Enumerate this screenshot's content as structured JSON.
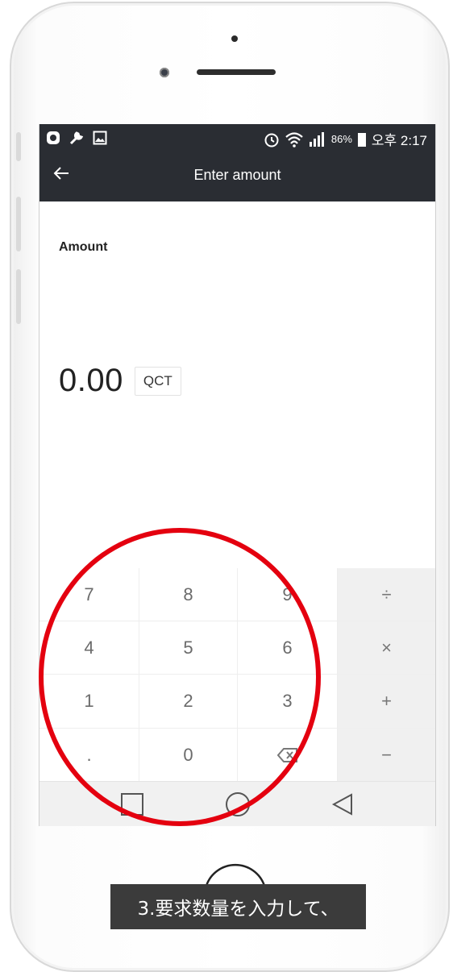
{
  "status_bar": {
    "battery_percent": "86%",
    "time": "오후 2:17",
    "left_icons": [
      "app-icon",
      "wrench-icon",
      "image-icon"
    ],
    "right_icons": [
      "alarm-icon",
      "wifi-icon",
      "signal-icon",
      "battery-icon"
    ]
  },
  "app_bar": {
    "back_icon": "arrow-left-icon",
    "title": "Enter amount"
  },
  "amount": {
    "label": "Amount",
    "value": "0.00",
    "unit": "QCT"
  },
  "keypad": {
    "rows": [
      [
        "7",
        "8",
        "9",
        "÷"
      ],
      [
        "4",
        "5",
        "6",
        "×"
      ],
      [
        "1",
        "2",
        "3",
        "+"
      ],
      [
        ".",
        "0",
        "backspace-icon",
        "−"
      ]
    ]
  },
  "nav_bar": [
    "square-icon",
    "circle-icon",
    "triangle-left-icon"
  ],
  "annotation": {
    "caption": "3.要求数量を入力して、",
    "highlight_color": "#e4000f"
  },
  "colors": {
    "app_bar": "#2a2d33",
    "operator_keys": "#f0f0f0"
  }
}
